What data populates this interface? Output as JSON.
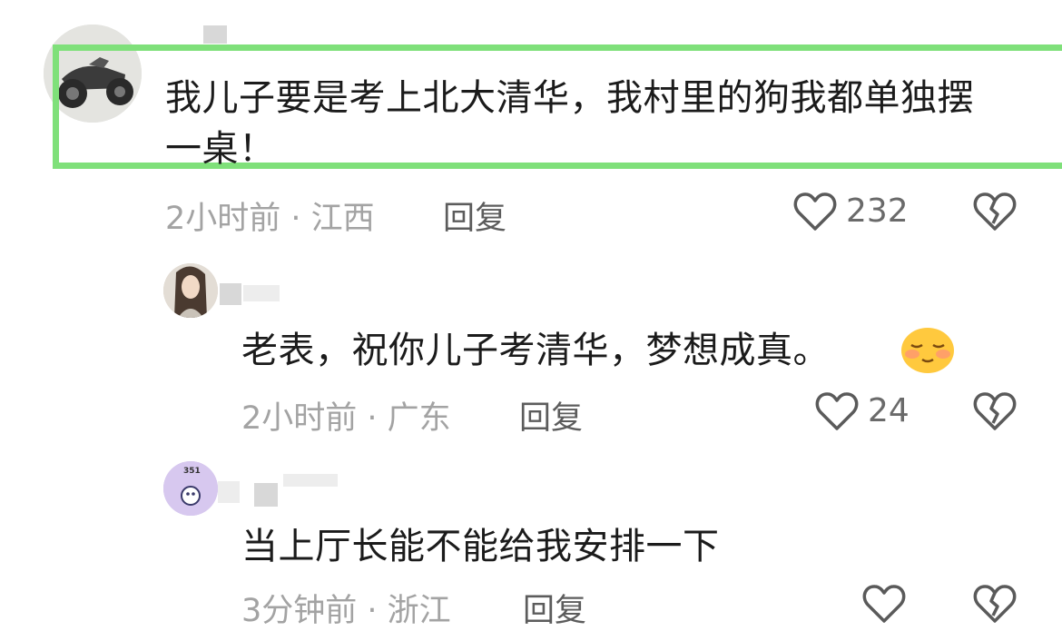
{
  "comments": [
    {
      "text": "我儿子要是考上北大清华，我村里的狗我都单独摆一桌！",
      "meta": "2小时前 · 江西",
      "reply": "回复",
      "likes": "232",
      "like_icon": "heart-outline-icon",
      "dislike_icon": "broken-heart-icon"
    },
    {
      "text": "老表，祝你儿子考清华，梦想成真。",
      "meta": "2小时前 · 广东",
      "reply": "回复",
      "likes": "24",
      "emoji": "shy-smile-emoji",
      "like_icon": "heart-outline-icon",
      "dislike_icon": "broken-heart-icon"
    },
    {
      "text": "当上厅长能不能给我安排一下",
      "meta": "3分钟前 · 浙江",
      "reply": "回复",
      "like_icon": "heart-outline-icon",
      "dislike_icon": "broken-heart-icon"
    }
  ],
  "avatar_badge": "351",
  "colors": {
    "highlight": "#7fe07a",
    "meta": "#a3a3a3",
    "reply": "#5c5c5c",
    "icon": "#5a5a5a"
  }
}
